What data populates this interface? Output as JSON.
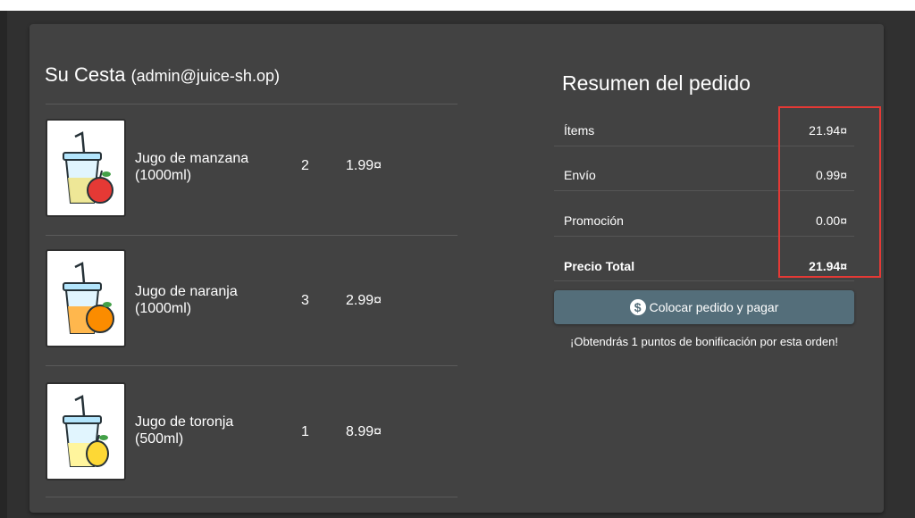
{
  "basket": {
    "title": "Su Cesta",
    "user": "(admin@juice-sh.op)",
    "items": [
      {
        "name": "Jugo de manzana (1000ml)",
        "quantity": "2",
        "price": "1.99¤",
        "fruit_icon": "apple-juice-icon"
      },
      {
        "name": "Jugo de naranja (1000ml)",
        "quantity": "3",
        "price": "2.99¤",
        "fruit_icon": "orange-juice-icon"
      },
      {
        "name": "Jugo de toronja (500ml)",
        "quantity": "1",
        "price": "8.99¤",
        "fruit_icon": "grapefruit-juice-icon"
      }
    ]
  },
  "summary": {
    "title": "Resumen del pedido",
    "rows": [
      {
        "label": "Ítems",
        "value": "21.94¤"
      },
      {
        "label": "Envío",
        "value": "0.99¤"
      },
      {
        "label": "Promoción",
        "value": "0.00¤"
      },
      {
        "label": "Precio Total",
        "value": "21.94¤"
      }
    ],
    "checkout_label": "Colocar pedido y pagar",
    "checkout_icon": "dollar-icon",
    "bonus_text": "¡Obtendrás 1 puntos de bonificación por esta orden!"
  },
  "colors": {
    "background": "#303030",
    "card": "#424242",
    "button": "#546e7a",
    "highlight": "#e53935"
  }
}
